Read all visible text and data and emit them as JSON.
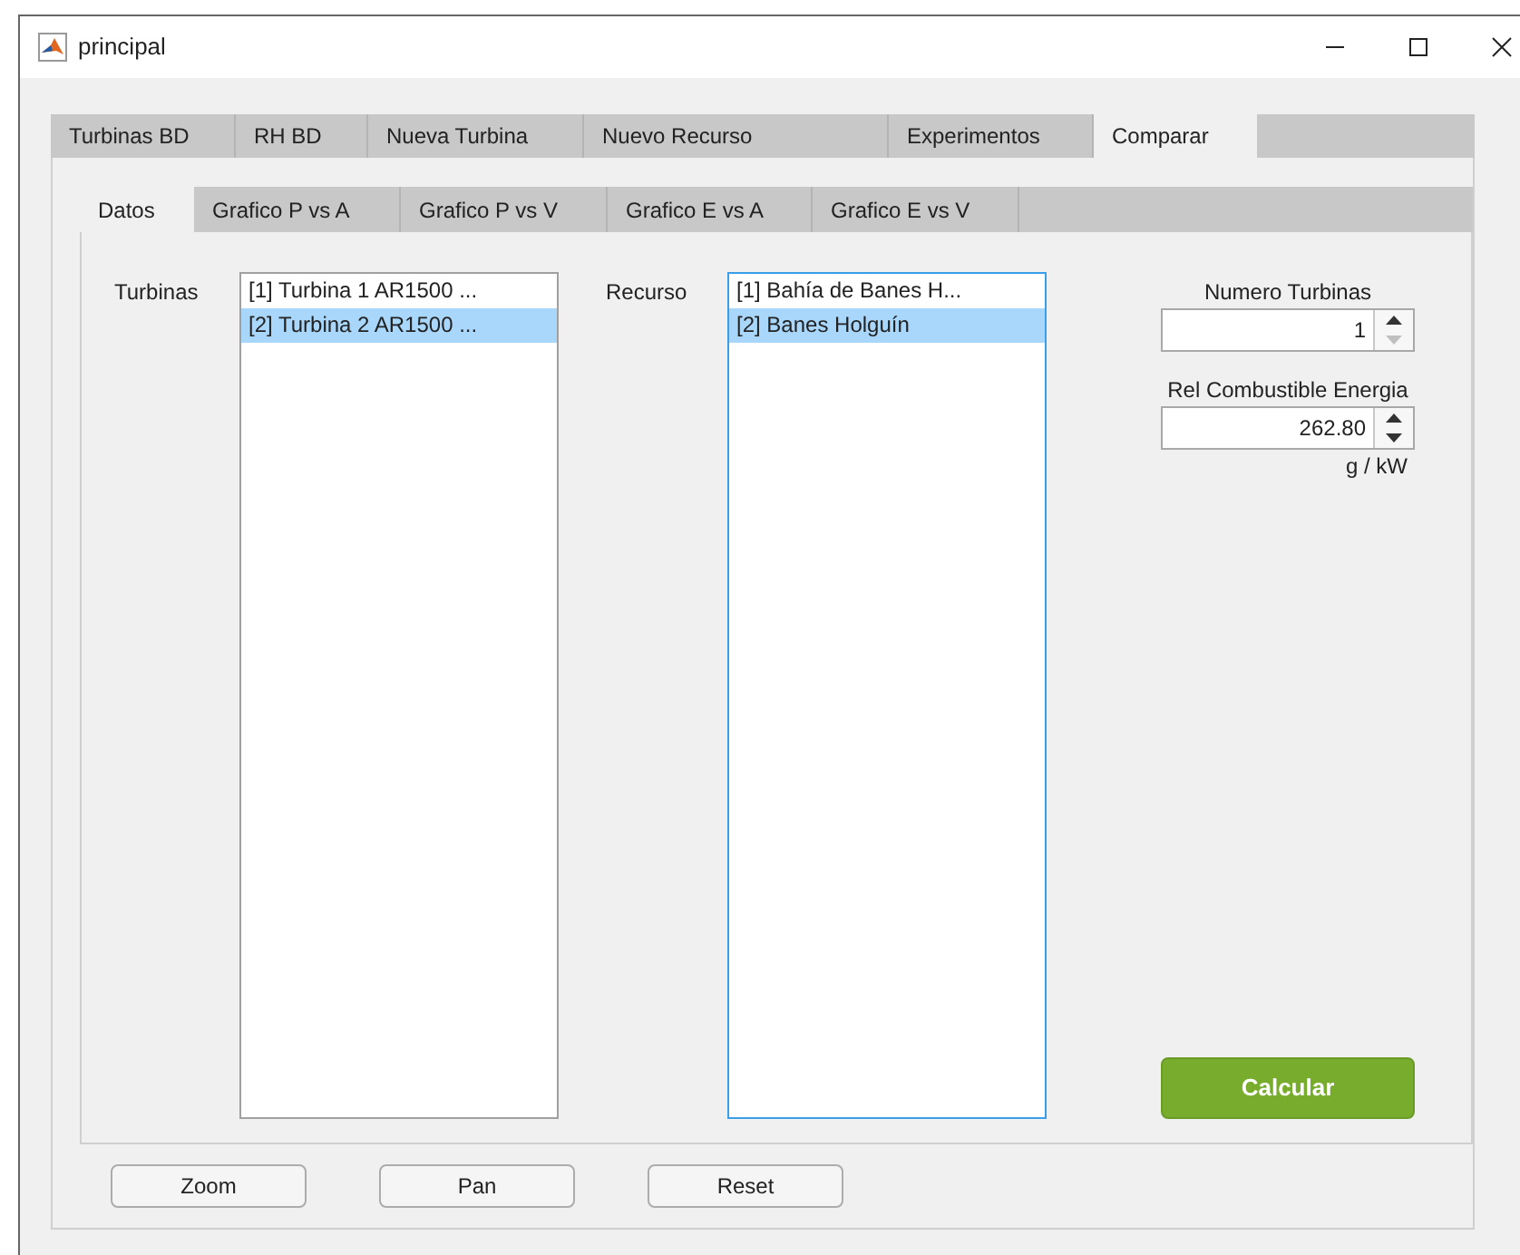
{
  "window": {
    "title": "principal"
  },
  "tabs": [
    {
      "label": "Turbinas BD",
      "selected": false
    },
    {
      "label": "RH BD",
      "selected": false
    },
    {
      "label": "Nueva Turbina",
      "selected": false
    },
    {
      "label": "Nuevo Recurso",
      "selected": false
    },
    {
      "label": "Experimentos",
      "selected": false
    },
    {
      "label": "Comparar",
      "selected": true
    }
  ],
  "subtabs": [
    {
      "label": "Datos",
      "selected": true
    },
    {
      "label": "Grafico P vs A",
      "selected": false
    },
    {
      "label": "Grafico P vs V",
      "selected": false
    },
    {
      "label": "Grafico E vs A",
      "selected": false
    },
    {
      "label": "Grafico E vs V",
      "selected": false
    }
  ],
  "turbinas": {
    "label": "Turbinas",
    "focused": false,
    "items": [
      {
        "text": "[1] Turbina 1  AR1500 ...",
        "selected": false
      },
      {
        "text": "[2] Turbina 2 AR1500 ...",
        "selected": true
      }
    ]
  },
  "recurso": {
    "label": "Recurso",
    "focused": true,
    "items": [
      {
        "text": "[1] Bahía de Banes  H...",
        "selected": false
      },
      {
        "text": "[2] Banes Holguín",
        "selected": true
      }
    ]
  },
  "spinners": [
    {
      "label": "Numero Turbinas",
      "value": "1",
      "decrement_disabled": true
    },
    {
      "label": "Rel Combustible Energia",
      "value": "262.80",
      "decrement_disabled": false,
      "unit": "g / kW"
    }
  ],
  "calculate_button": "Calcular",
  "buttons": [
    "Zoom",
    "Pan",
    "Reset"
  ]
}
